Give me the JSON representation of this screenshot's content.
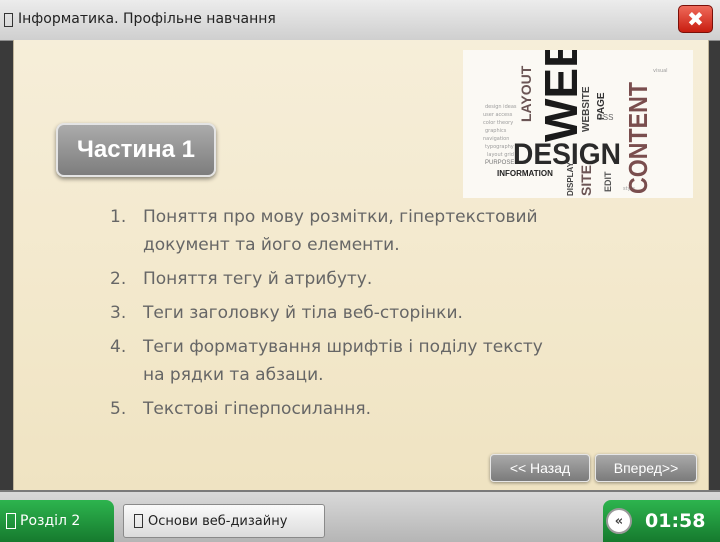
{
  "window": {
    "title": "Інформатика. Профільне навчання",
    "close_label": "✖",
    "icon": "document-icon"
  },
  "image": {
    "words": [
      "WEB",
      "DESIGN",
      "CONTENT",
      "LAYOUT",
      "WEBSITE",
      "PAGE",
      "SITE",
      "INFORMATION",
      "DISPLAY",
      "EDIT",
      "CSS",
      "PURPOSE"
    ]
  },
  "part": {
    "label": "Частина 1"
  },
  "topics": [
    {
      "num": "1.",
      "line1": "Поняття про мову розмітки, гіпертекстовий",
      "line2": "документ та його елементи."
    },
    {
      "num": "2.",
      "line1": "Поняття тегу й атрибуту.",
      "line2": ""
    },
    {
      "num": "3.",
      "line1": "Теги заголовку й тіла веб-сторінки.",
      "line2": ""
    },
    {
      "num": "4.",
      "line1": "Теги форматування шрифтів і поділу тексту",
      "line2": "на рядки та абзаци."
    },
    {
      "num": "5.",
      "line1": "Текстові гіперпосилання.",
      "line2": ""
    }
  ],
  "nav": {
    "back_label": "<< Назад",
    "next_label": "Вперед>>"
  },
  "footer": {
    "section_label": "Розділ 2",
    "topic_label": "Основи веб-дизайну",
    "timer_icon": "back-arrow-icon",
    "timer_icon_glyph": "«",
    "timer": "01:58"
  },
  "colors": {
    "accent_green": "#1f9a3c",
    "close_red": "#d9291b",
    "button_gray": "#8e8e8e",
    "panel_bg": "#f3e9cd"
  }
}
